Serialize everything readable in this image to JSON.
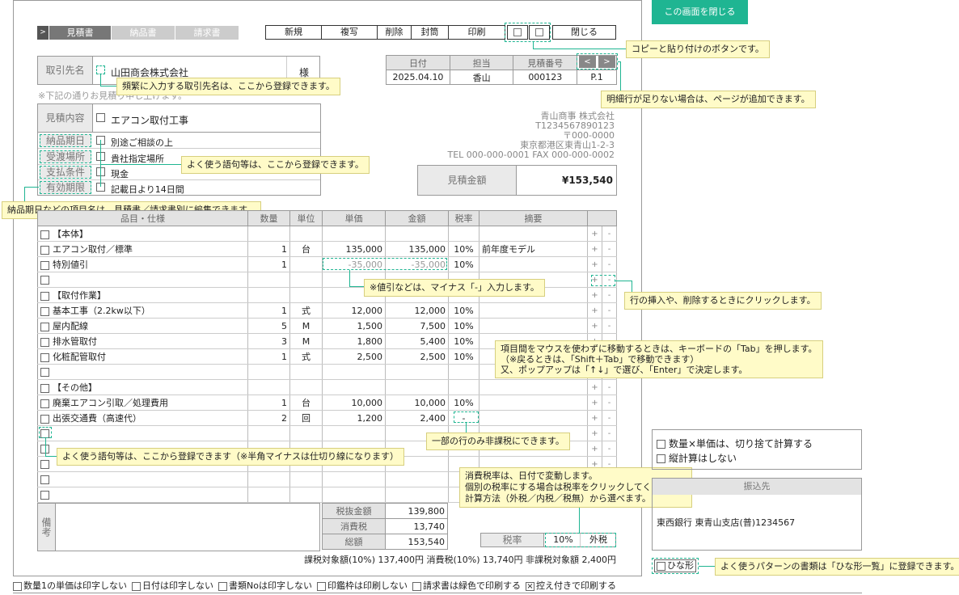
{
  "close_screen": "この画面を閉じる",
  "tabs": [
    "見積書",
    "納品書",
    "請求書"
  ],
  "toolbar": {
    "new": "新規",
    "duplicate": "複写",
    "delete": "削除",
    "envelope": "封筒",
    "print": "印刷",
    "close": "閉じる"
  },
  "client": {
    "label": "取引先名",
    "value": "山田商会株式会社",
    "suffix": "様"
  },
  "note_line": "※下記の通りお見積り申し上げます。",
  "header_info": {
    "headers": [
      "日付",
      "担当",
      "見積番号"
    ],
    "values": [
      "2025.04.10",
      "香山",
      "000123"
    ],
    "page": "P.1"
  },
  "fields": [
    {
      "label": "見積内容",
      "value": "エアコン取付工事"
    },
    {
      "label": "納品期日",
      "value": "別途ご相談の上"
    },
    {
      "label": "受渡場所",
      "value": "貴社指定場所"
    },
    {
      "label": "支払条件",
      "value": "現金"
    },
    {
      "label": "有効期限",
      "value": "記載日より14日間"
    }
  ],
  "company": {
    "name": "青山商事 株式会社",
    "reg": "T1234567890123",
    "zip": "〒000-0000",
    "address": "東京都港区東青山1-2-3",
    "tel": "TEL 000-000-0001  FAX 000-000-0002"
  },
  "total_box": {
    "label": "見積金額",
    "value": "¥153,540"
  },
  "columns": [
    "品目・仕様",
    "数量",
    "単位",
    "単価",
    "金額",
    "税率",
    "摘要"
  ],
  "rows": [
    {
      "name": "【本体】",
      "qty": "",
      "unit": "",
      "price": "",
      "amount": "",
      "tax": "",
      "note": ""
    },
    {
      "name": "エアコン取付／標準",
      "qty": "1",
      "unit": "台",
      "price": "135,000",
      "amount": "135,000",
      "tax": "10%",
      "note": "前年度モデル"
    },
    {
      "name": "特別値引",
      "qty": "1",
      "unit": "",
      "price": "-35,000",
      "amount": "-35,000",
      "tax": "10%",
      "note": ""
    },
    {
      "name": "",
      "qty": "",
      "unit": "",
      "price": "",
      "amount": "",
      "tax": "",
      "note": ""
    },
    {
      "name": "【取付作業】",
      "qty": "",
      "unit": "",
      "price": "",
      "amount": "",
      "tax": "",
      "note": ""
    },
    {
      "name": "基本工事（2.2kw以下）",
      "qty": "1",
      "unit": "式",
      "price": "12,000",
      "amount": "12,000",
      "tax": "10%",
      "note": ""
    },
    {
      "name": "屋内配線",
      "qty": "5",
      "unit": "M",
      "price": "1,500",
      "amount": "7,500",
      "tax": "10%",
      "note": ""
    },
    {
      "name": "排水管取付",
      "qty": "3",
      "unit": "M",
      "price": "1,800",
      "amount": "5,400",
      "tax": "10%",
      "note": ""
    },
    {
      "name": "化粧配管取付",
      "qty": "1",
      "unit": "式",
      "price": "2,500",
      "amount": "2,500",
      "tax": "10%",
      "note": ""
    },
    {
      "name": "",
      "qty": "",
      "unit": "",
      "price": "",
      "amount": "",
      "tax": "",
      "note": ""
    },
    {
      "name": "【その他】",
      "qty": "",
      "unit": "",
      "price": "",
      "amount": "",
      "tax": "",
      "note": ""
    },
    {
      "name": "廃棄エアコン引取／処理費用",
      "qty": "1",
      "unit": "台",
      "price": "10,000",
      "amount": "10,000",
      "tax": "10%",
      "note": ""
    },
    {
      "name": "出張交通費（高速代）",
      "qty": "2",
      "unit": "回",
      "price": "1,200",
      "amount": "2,400",
      "tax": "-",
      "note": ""
    },
    {
      "name": "",
      "qty": "",
      "unit": "",
      "price": "",
      "amount": "",
      "tax": "",
      "note": ""
    },
    {
      "name": "",
      "qty": "",
      "unit": "",
      "price": "",
      "amount": "",
      "tax": "",
      "note": ""
    },
    {
      "name": "",
      "qty": "",
      "unit": "",
      "price": "",
      "amount": "",
      "tax": "",
      "note": ""
    },
    {
      "name": "",
      "qty": "",
      "unit": "",
      "price": "",
      "amount": "",
      "tax": "",
      "note": ""
    },
    {
      "name": "",
      "qty": "",
      "unit": "",
      "price": "",
      "amount": "",
      "tax": "",
      "note": ""
    }
  ],
  "remarks_label": "備考",
  "summary": [
    {
      "label": "税抜金額",
      "value": "139,800"
    },
    {
      "label": "消費税",
      "value": "13,740"
    },
    {
      "label": "総額",
      "value": "153,540"
    }
  ],
  "tax_rate": {
    "label": "税率",
    "rate": "10%",
    "mode": "外税"
  },
  "tax_summary": "課税対象額(10%) 137,400円  消費税(10%) 13,740円  非課税対象額 2,400円",
  "bottom_options": [
    {
      "label": "数量1の単価は印字しない",
      "checked": false
    },
    {
      "label": "日付は印字しない",
      "checked": false
    },
    {
      "label": "書類Noは印字しない",
      "checked": false
    },
    {
      "label": "印鑑枠は印刷しない",
      "checked": false
    },
    {
      "label": "請求書は緑色で印刷する",
      "checked": false
    },
    {
      "label": "控え付きで印刷する",
      "checked": true
    }
  ],
  "calc_options": [
    "数量×単価は、切り捨て計算する",
    "縦計算はしない"
  ],
  "bank": {
    "header": "振込先",
    "value": "東西銀行  東青山支店(普)1234567"
  },
  "template_btn": "ひな形",
  "tips": {
    "copy_paste": "コピーと貼り付けのボタンです。",
    "client_register": "頻繁に入力する取引先名は、ここから登録できます。",
    "page_add": "明細行が足りない場合は、ページが追加できます。",
    "phrase_register": "よく使う語句等は、ここから登録できます。",
    "item_names": "納品期日などの項目名は、見積書／請求書別に編集できます。",
    "minus": "※値引などは、マイナス「-」入力します。",
    "row_insert": "行の挿入や、削除するときにクリックします。",
    "keyboard": [
      "項目間をマウスを使わずに移動するときは、キーボードの「Tab」を押します。",
      "（※戻るときは、「Shift＋Tab」で移動できます）",
      "又、ポップアップは「↑↓」で選び、「Enter」で決定します。"
    ],
    "nontax": "一部の行のみ非課税にできます。",
    "phrase_register2": "よく使う語句等は、ここから登録できます（※半角マイナスは仕切り線になります）",
    "tax_rate": [
      "消費税率は、日付で変動します。",
      "個別の税率にする場合は税率をクリックしてください。",
      "計算方法（外税／内税／税無）から選べます。"
    ],
    "template": "よく使うパターンの書類は「ひな形一覧」に登録できます。"
  }
}
